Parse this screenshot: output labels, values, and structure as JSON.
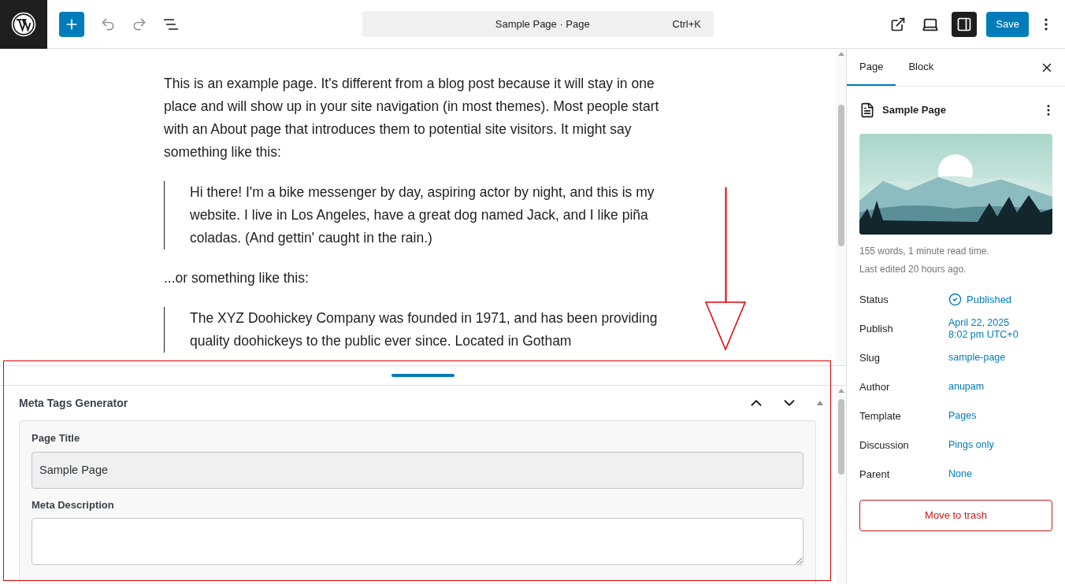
{
  "topbar": {
    "command": {
      "title": "Sample Page · Page",
      "shortcut": "Ctrl+K"
    },
    "settings_pressed": true,
    "save": "Save"
  },
  "content": [
    {
      "kind": "paragraph",
      "text": "This is an example page. It's different from a blog post because it will stay in one place and will show up in your site navigation (in most themes). Most people start with an About page that introduces them to potential site visitors. It might say something like this:"
    },
    {
      "kind": "quote",
      "text": "Hi there! I'm a bike messenger by day, aspiring actor by night, and this is my website. I live in Los Angeles, have a great dog named Jack, and I like piña coladas. (And gettin' caught in the rain.)"
    },
    {
      "kind": "paragraph",
      "text": "...or something like this:"
    },
    {
      "kind": "quote",
      "text": "The XYZ Doohickey Company was founded in 1971, and has been providing quality doohickeys to the public ever since. Located in Gotham"
    }
  ],
  "metabox": {
    "title": "Meta Tags Generator",
    "expanded": true,
    "fields": [
      {
        "kind": "input",
        "label": "Page Title",
        "value": "Sample Page",
        "readonly": true
      },
      {
        "kind": "textarea",
        "label": "Meta Description"
      }
    ]
  },
  "sidebar": {
    "tabs": [
      {
        "label": "Page",
        "selected": true
      },
      {
        "label": "Block",
        "selected": false
      }
    ],
    "title": "Sample Page",
    "meta": [
      "155 words, 1 minute read time.",
      "Last edited 20 hours ago."
    ],
    "rows": [
      {
        "label": "Status",
        "value": "Published",
        "kind": "status"
      },
      {
        "label": "Publish",
        "value": "April 22, 2025\n8:02 pm UTC+0",
        "kind": "link"
      },
      {
        "label": "Slug",
        "value": "sample-page",
        "kind": "link"
      },
      {
        "label": "Author",
        "value": "anupam",
        "kind": "link"
      },
      {
        "label": "Template",
        "value": "Pages",
        "kind": "link"
      },
      {
        "label": "Discussion",
        "value": "Pings only",
        "kind": "link"
      },
      {
        "label": "Parent",
        "value": "None",
        "kind": "link"
      }
    ],
    "trash": "Move to trash"
  }
}
